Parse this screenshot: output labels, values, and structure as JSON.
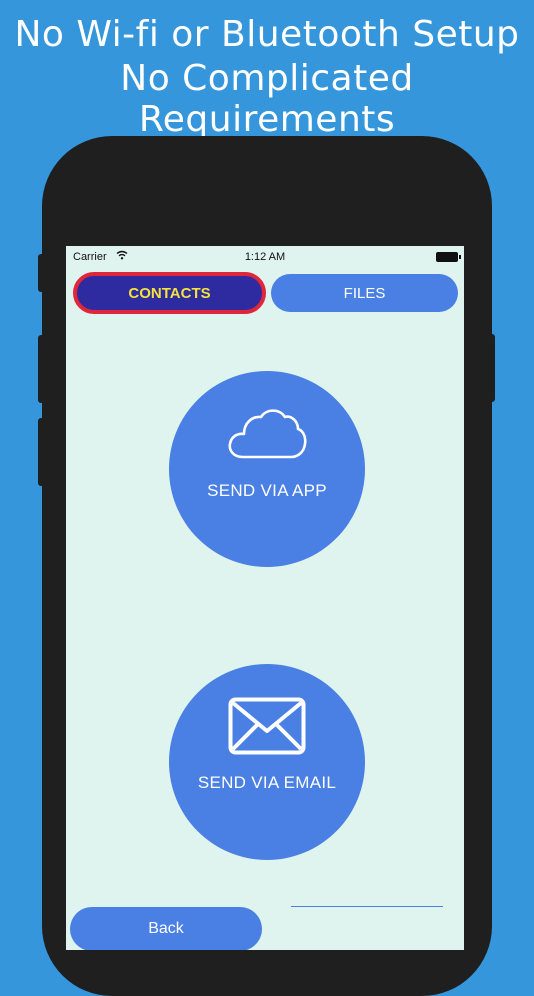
{
  "headline": {
    "line1": "No Wi-fi or Bluetooth Setup",
    "line2": "No Complicated Requirements"
  },
  "status_bar": {
    "carrier": "Carrier",
    "time": "1:12 AM",
    "icons": [
      "wifi-icon",
      "battery-icon"
    ]
  },
  "tabs": [
    {
      "label": "CONTACTS",
      "selected": true
    },
    {
      "label": "FILES",
      "selected": false
    }
  ],
  "actions": {
    "send_app": {
      "label": "SEND VIA APP",
      "icon": "cloud-icon"
    },
    "send_email": {
      "label": "SEND VIA EMAIL",
      "icon": "envelope-icon"
    }
  },
  "footer": {
    "back_label": "Back"
  },
  "colors": {
    "background": "#3596dc",
    "screen": "#dff4ef",
    "accent": "#4a7fe4",
    "selected_tab": "#2e2aa0",
    "selected_tab_text": "#f2e23a",
    "selected_tab_border": "#e0263a"
  }
}
